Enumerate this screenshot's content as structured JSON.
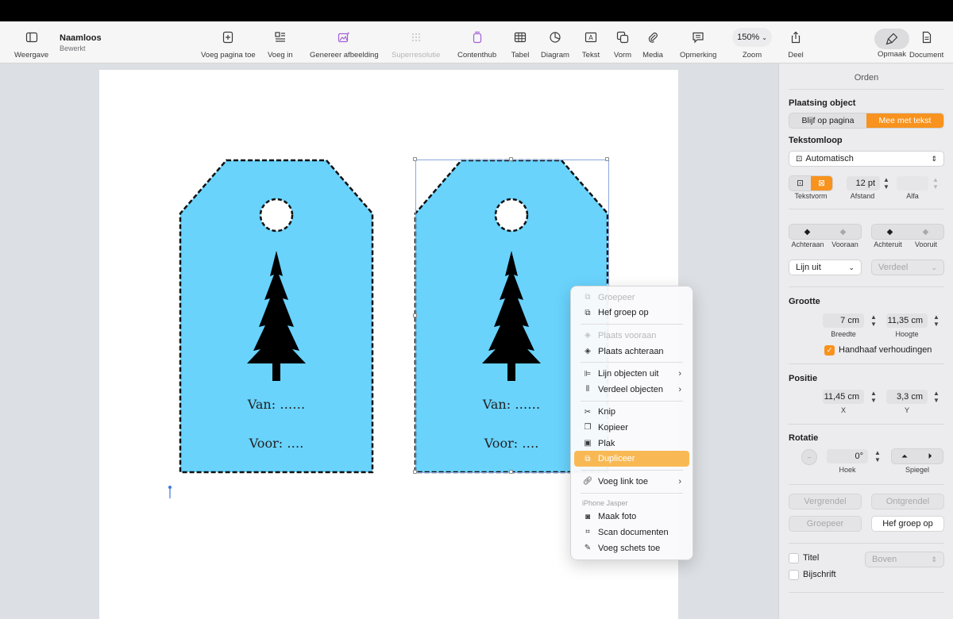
{
  "toolbar": {
    "view_label": "Weergave",
    "doc_title": "Naamloos",
    "doc_status": "Bewerkt",
    "add_page": "Voeg pagina toe",
    "insert": "Voeg in",
    "generate_image": "Genereer afbeelding",
    "super_resolution": "Superresolutie",
    "content_hub": "Contenthub",
    "table": "Tabel",
    "chart": "Diagram",
    "text": "Tekst",
    "shape": "Vorm",
    "media": "Media",
    "comment": "Opmerking",
    "zoom_value": "150%",
    "zoom_label": "Zoom",
    "share": "Deel",
    "format": "Opmaak",
    "document": "Document"
  },
  "tags": [
    {
      "from_text": "Van: ……",
      "to_text": "Voor: …."
    },
    {
      "from_text": "Van: ……",
      "to_text": "Voor: …."
    }
  ],
  "context_menu": {
    "group": "Groepeer",
    "ungroup": "Hef groep op",
    "bring_front": "Plaats vooraan",
    "send_back": "Plaats achteraan",
    "align": "Lijn objecten uit",
    "distribute": "Verdeel objecten",
    "cut": "Knip",
    "copy": "Kopieer",
    "paste": "Plak",
    "duplicate": "Dupliceer",
    "add_link": "Voeg link toe",
    "device_section": "iPhone Jasper",
    "take_photo": "Maak foto",
    "scan_docs": "Scan documenten",
    "add_sketch": "Voeg schets toe"
  },
  "inspector": {
    "title": "Orden",
    "placement_heading": "Plaatsing object",
    "stay_on_page": "Blijf op pagina",
    "move_with_text": "Mee met tekst",
    "wrap_heading": "Tekstomloop",
    "wrap_value": "Automatisch",
    "text_fit_label": "Tekstvorm",
    "spacing_value": "12 pt",
    "spacing_label": "Afstand",
    "alpha_label": "Alfa",
    "back_label": "Achteraan",
    "front_label": "Vooraan",
    "backward_label": "Achteruit",
    "forward_label": "Vooruit",
    "align_value": "Lijn uit",
    "distribute_value": "Verdeel",
    "size_heading": "Grootte",
    "width_value": "7 cm",
    "width_label": "Breedte",
    "height_value": "11,35 cm",
    "height_label": "Hoogte",
    "constrain_label": "Handhaaf verhoudingen",
    "position_heading": "Positie",
    "x_value": "11,45 cm",
    "x_label": "X",
    "y_value": "3,3 cm",
    "y_label": "Y",
    "rotation_heading": "Rotatie",
    "angle_value": "0°",
    "angle_label": "Hoek",
    "flip_label": "Spiegel",
    "lock": "Vergrendel",
    "unlock": "Ontgrendel",
    "group": "Groepeer",
    "ungroup": "Hef groep op",
    "title_label": "Titel",
    "title_pos_value": "Boven",
    "caption_label": "Bijschrift"
  },
  "colors": {
    "tag_fill": "#69d3fc",
    "accent": "#f7931e",
    "menu_highlight": "#f8b955"
  }
}
